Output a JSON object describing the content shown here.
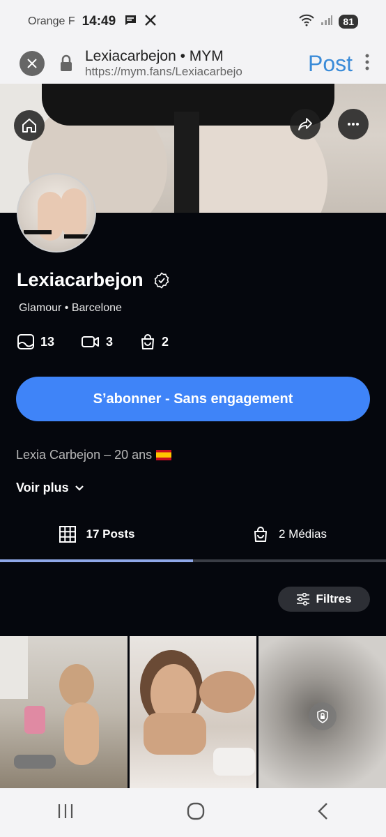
{
  "status_bar": {
    "carrier": "Orange F",
    "time": "14:49",
    "battery": "81",
    "notif_icons": [
      "message-icon",
      "x-icon"
    ]
  },
  "browser": {
    "title": "Lexiacarbejon • MYM",
    "url": "https://mym.fans/Lexiacarbejo",
    "post_label": "Post"
  },
  "profile": {
    "name": "Lexiacarbejon",
    "subtitle": "Glamour • Barcelone",
    "stats": [
      {
        "icon": "photo-icon",
        "value": "13"
      },
      {
        "icon": "video-icon",
        "value": "3"
      },
      {
        "icon": "bag-icon",
        "value": "2"
      }
    ],
    "subscribe_label": "S’abonner - Sans engagement",
    "bio": "Lexia Carbejon – 20 ans",
    "more_label": "Voir plus"
  },
  "tabs": [
    {
      "label": "17 Posts",
      "icon": "grid-icon",
      "active": true
    },
    {
      "label": "2 Médias",
      "icon": "bag-icon",
      "active": false
    }
  ],
  "filters_label": "Filtres",
  "colors": {
    "accent": "#3f84f8",
    "background": "#05070d",
    "tab_indicator": "#8fa8e8"
  }
}
